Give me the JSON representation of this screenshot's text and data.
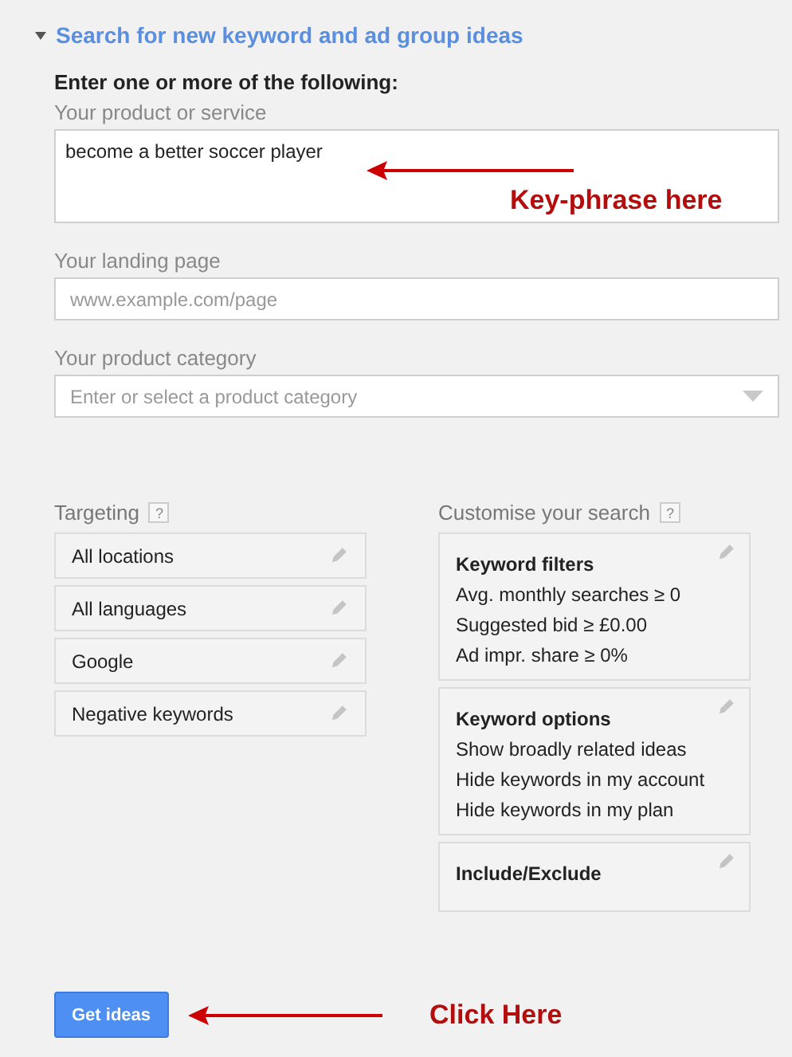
{
  "section": {
    "title": "Search for new keyword and ad group ideas",
    "expanded": true
  },
  "instruction": "Enter one or more of the following:",
  "fields": [
    {
      "kind": "textarea",
      "label": "Your product or service",
      "value": "become a better soccer player",
      "annotation": "Key-phrase here"
    },
    {
      "kind": "text",
      "label": "Your landing page",
      "placeholder": "www.example.com/page"
    },
    {
      "kind": "dropdown",
      "label": "Your product category",
      "placeholder": "Enter or select a product category"
    }
  ],
  "targeting": {
    "title": "Targeting",
    "help": "?",
    "items": [
      "All locations",
      "All languages",
      "Google",
      "Negative keywords"
    ]
  },
  "customise": {
    "title": "Customise your search",
    "help": "?",
    "cards": [
      {
        "title": "Keyword filters",
        "lines": [
          "Avg. monthly searches ≥ 0",
          "Suggested bid ≥ £0.00",
          "Ad impr. share ≥ 0%"
        ]
      },
      {
        "title": "Keyword options",
        "lines": [
          "Show broadly related ideas",
          "Hide keywords in my account",
          "Hide keywords in my plan"
        ]
      },
      {
        "title": "Include/Exclude"
      }
    ]
  },
  "button": {
    "label": "Get ideas",
    "annotation": "Click Here"
  }
}
